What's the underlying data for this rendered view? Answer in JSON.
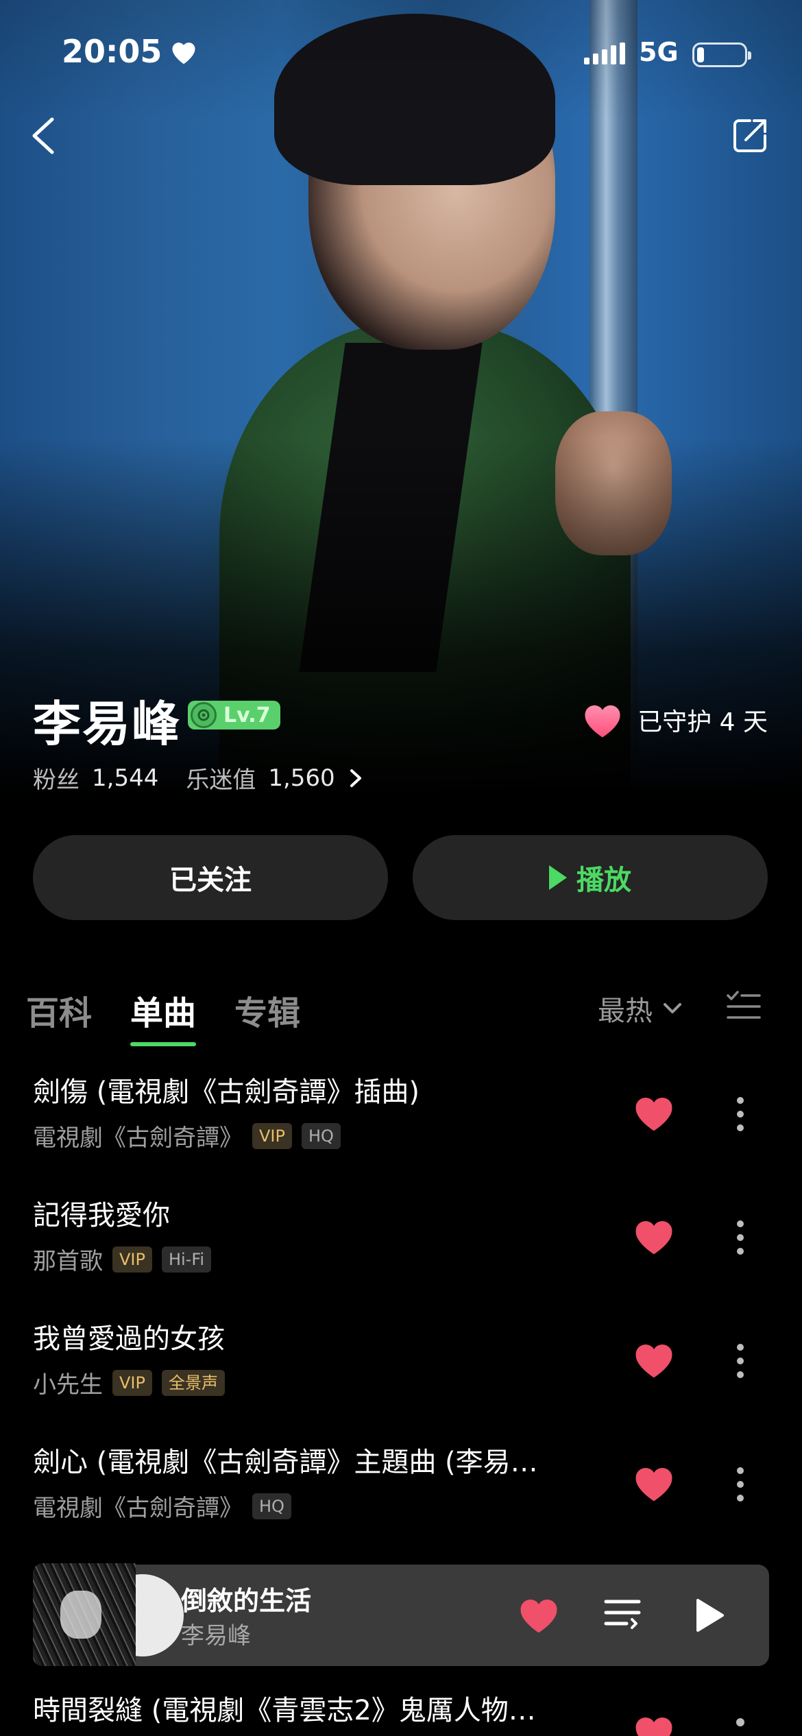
{
  "status_bar": {
    "time": "20:05",
    "network": "5G"
  },
  "artist": {
    "name": "李易峰",
    "level": "Lv.7",
    "guard_text": "已守护 4 天",
    "fans_label": "粉丝",
    "fans_value": "1,544",
    "fan_score_label": "乐迷值",
    "fan_score_value": "1,560"
  },
  "actions": {
    "follow_label": "已关注",
    "play_label": "播放"
  },
  "tabs": [
    {
      "label": "百科"
    },
    {
      "label": "单曲"
    },
    {
      "label": "专辑"
    }
  ],
  "sort_label": "最热",
  "songs": [
    {
      "title": "劍傷 (電視劇《古劍奇譚》插曲)",
      "album": "電視劇《古劍奇譚》",
      "tags": [
        "VIP",
        "HQ"
      ]
    },
    {
      "title": "記得我愛你",
      "album": "那首歌",
      "tags": [
        "VIP",
        "Hi-Fi"
      ]
    },
    {
      "title": "我曾愛過的女孩",
      "album": "小先生",
      "tags": [
        "VIP",
        "全景声"
      ]
    },
    {
      "title": "劍心 (電視劇《古劍奇譚》主題曲 (李易…",
      "album": "電視劇《古劍奇譚》",
      "tags": [
        "HQ"
      ]
    }
  ],
  "partial_song": {
    "title": "時間裂縫 (電視劇《青雲志2》鬼厲人物…"
  },
  "now_playing": {
    "title": "倒敘的生活",
    "artist": "李易峰"
  },
  "colors": {
    "accent": "#4cd964",
    "heart": "#f0506a",
    "background": "#000000"
  }
}
